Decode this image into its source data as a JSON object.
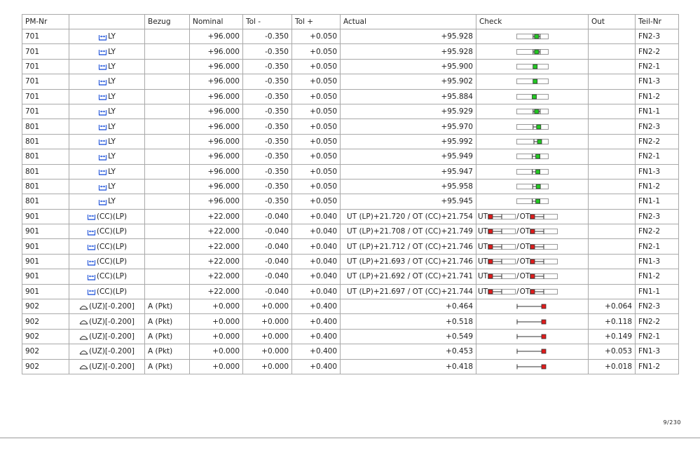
{
  "columns": [
    "PM-Nr",
    "",
    "Bezug",
    "Nominal",
    "Tol -",
    "Tol +",
    "Actual",
    "Check",
    "Out",
    "Teil-Nr"
  ],
  "colors": {
    "ok": "#22c922",
    "fail": "#e01b1b",
    "icon": "#1a4fd8"
  },
  "rows": [
    {
      "pm": "701",
      "sym_icon": "distance-y-icon",
      "feature": "LY",
      "bezug": "",
      "nominal": "+96.000",
      "tol_minus": "-0.350",
      "tol_plus": "+0.050",
      "actual": "+95.928",
      "check": {
        "kind": "single",
        "pos": 0.86,
        "status": "ok",
        "whisker": "both"
      },
      "out": "",
      "teil": "FN2-3"
    },
    {
      "pm": "701",
      "sym_icon": "distance-y-icon",
      "feature": "LY",
      "bezug": "",
      "nominal": "+96.000",
      "tol_minus": "-0.350",
      "tol_plus": "+0.050",
      "actual": "+95.928",
      "check": {
        "kind": "single",
        "pos": 0.86,
        "status": "ok",
        "whisker": "both"
      },
      "out": "",
      "teil": "FN2-2"
    },
    {
      "pm": "701",
      "sym_icon": "distance-y-icon",
      "feature": "LY",
      "bezug": "",
      "nominal": "+96.000",
      "tol_minus": "-0.350",
      "tol_plus": "+0.050",
      "actual": "+95.900",
      "check": {
        "kind": "single",
        "pos": 0.79,
        "status": "ok",
        "whisker": "none"
      },
      "out": "",
      "teil": "FN2-1"
    },
    {
      "pm": "701",
      "sym_icon": "distance-y-icon",
      "feature": "LY",
      "bezug": "",
      "nominal": "+96.000",
      "tol_minus": "-0.350",
      "tol_plus": "+0.050",
      "actual": "+95.902",
      "check": {
        "kind": "single",
        "pos": 0.79,
        "status": "ok",
        "whisker": "none"
      },
      "out": "",
      "teil": "FN1-3"
    },
    {
      "pm": "701",
      "sym_icon": "distance-y-icon",
      "feature": "LY",
      "bezug": "",
      "nominal": "+96.000",
      "tol_minus": "-0.350",
      "tol_plus": "+0.050",
      "actual": "+95.884",
      "check": {
        "kind": "single",
        "pos": 0.75,
        "status": "ok",
        "whisker": "none"
      },
      "out": "",
      "teil": "FN1-2"
    },
    {
      "pm": "701",
      "sym_icon": "distance-y-icon",
      "feature": "LY",
      "bezug": "",
      "nominal": "+96.000",
      "tol_minus": "-0.350",
      "tol_plus": "+0.050",
      "actual": "+95.929",
      "check": {
        "kind": "single",
        "pos": 0.86,
        "status": "ok",
        "whisker": "both"
      },
      "out": "",
      "teil": "FN1-1"
    },
    {
      "pm": "801",
      "sym_icon": "distance-y-icon",
      "feature": "LY",
      "bezug": "",
      "nominal": "+96.000",
      "tol_minus": "-0.350",
      "tol_plus": "+0.050",
      "actual": "+95.970",
      "check": {
        "kind": "single",
        "pos": 0.96,
        "status": "ok",
        "whisker": "left"
      },
      "out": "",
      "teil": "FN2-3"
    },
    {
      "pm": "801",
      "sym_icon": "distance-y-icon",
      "feature": "LY",
      "bezug": "",
      "nominal": "+96.000",
      "tol_minus": "-0.350",
      "tol_plus": "+0.050",
      "actual": "+95.992",
      "check": {
        "kind": "single",
        "pos": 1.0,
        "status": "ok",
        "whisker": "left"
      },
      "out": "",
      "teil": "FN2-2"
    },
    {
      "pm": "801",
      "sym_icon": "distance-y-icon",
      "feature": "LY",
      "bezug": "",
      "nominal": "+96.000",
      "tol_minus": "-0.350",
      "tol_plus": "+0.050",
      "actual": "+95.949",
      "check": {
        "kind": "single",
        "pos": 0.92,
        "status": "ok",
        "whisker": "left"
      },
      "out": "",
      "teil": "FN2-1"
    },
    {
      "pm": "801",
      "sym_icon": "distance-y-icon",
      "feature": "LY",
      "bezug": "",
      "nominal": "+96.000",
      "tol_minus": "-0.350",
      "tol_plus": "+0.050",
      "actual": "+95.947",
      "check": {
        "kind": "single",
        "pos": 0.92,
        "status": "ok",
        "whisker": "left"
      },
      "out": "",
      "teil": "FN1-3"
    },
    {
      "pm": "801",
      "sym_icon": "distance-y-icon",
      "feature": "LY",
      "bezug": "",
      "nominal": "+96.000",
      "tol_minus": "-0.350",
      "tol_plus": "+0.050",
      "actual": "+95.958",
      "check": {
        "kind": "single",
        "pos": 0.94,
        "status": "ok",
        "whisker": "left"
      },
      "out": "",
      "teil": "FN1-2"
    },
    {
      "pm": "801",
      "sym_icon": "distance-y-icon",
      "feature": "LY",
      "bezug": "",
      "nominal": "+96.000",
      "tol_minus": "-0.350",
      "tol_plus": "+0.050",
      "actual": "+95.945",
      "check": {
        "kind": "single",
        "pos": 0.92,
        "status": "ok",
        "whisker": "left"
      },
      "out": "",
      "teil": "FN1-1"
    },
    {
      "pm": "901",
      "sym_icon": "distance-y-icon",
      "feature": "(CC)(LP)",
      "bezug": "",
      "nominal": "+22.000",
      "tol_minus": "-0.040",
      "tol_plus": "+0.040",
      "actual": "UT (LP)+21.720 / OT (CC)+21.754",
      "check": {
        "kind": "dual",
        "ut_label": "UT",
        "sep": "/",
        "ot_label": "OT"
      },
      "out": "",
      "teil": "FN2-3"
    },
    {
      "pm": "901",
      "sym_icon": "distance-y-icon",
      "feature": "(CC)(LP)",
      "bezug": "",
      "nominal": "+22.000",
      "tol_minus": "-0.040",
      "tol_plus": "+0.040",
      "actual": "UT (LP)+21.708 / OT (CC)+21.749",
      "check": {
        "kind": "dual",
        "ut_label": "UT",
        "sep": "/",
        "ot_label": "OT"
      },
      "out": "",
      "teil": "FN2-2"
    },
    {
      "pm": "901",
      "sym_icon": "distance-y-icon",
      "feature": "(CC)(LP)",
      "bezug": "",
      "nominal": "+22.000",
      "tol_minus": "-0.040",
      "tol_plus": "+0.040",
      "actual": "UT (LP)+21.712 / OT (CC)+21.746",
      "check": {
        "kind": "dual",
        "ut_label": "UT",
        "sep": "/",
        "ot_label": "OT"
      },
      "out": "",
      "teil": "FN2-1"
    },
    {
      "pm": "901",
      "sym_icon": "distance-y-icon",
      "feature": "(CC)(LP)",
      "bezug": "",
      "nominal": "+22.000",
      "tol_minus": "-0.040",
      "tol_plus": "+0.040",
      "actual": "UT (LP)+21.693 / OT (CC)+21.746",
      "check": {
        "kind": "dual",
        "ut_label": "UT",
        "sep": "/",
        "ot_label": "OT"
      },
      "out": "",
      "teil": "FN1-3"
    },
    {
      "pm": "901",
      "sym_icon": "distance-y-icon",
      "feature": "(CC)(LP)",
      "bezug": "",
      "nominal": "+22.000",
      "tol_minus": "-0.040",
      "tol_plus": "+0.040",
      "actual": "UT (LP)+21.692 / OT (CC)+21.741",
      "check": {
        "kind": "dual",
        "ut_label": "UT",
        "sep": "/",
        "ot_label": "OT"
      },
      "out": "",
      "teil": "FN1-2"
    },
    {
      "pm": "901",
      "sym_icon": "distance-y-icon",
      "feature": "(CC)(LP)",
      "bezug": "",
      "nominal": "+22.000",
      "tol_minus": "-0.040",
      "tol_plus": "+0.040",
      "actual": "UT (LP)+21.697 / OT (CC)+21.744",
      "check": {
        "kind": "dual",
        "ut_label": "UT",
        "sep": "/",
        "ot_label": "OT"
      },
      "out": "",
      "teil": "FN1-1"
    },
    {
      "pm": "902",
      "sym_icon": "surface-profile-icon",
      "feature": "(UZ)[-0.200]",
      "bezug": "A (Pkt)",
      "nominal": "+0.000",
      "tol_minus": "+0.000",
      "tol_plus": "+0.400",
      "actual": "+0.464",
      "check": {
        "kind": "over",
        "status": "fail"
      },
      "out": "+0.064",
      "teil": "FN2-3"
    },
    {
      "pm": "902",
      "sym_icon": "surface-profile-icon",
      "feature": "(UZ)[-0.200]",
      "bezug": "A (Pkt)",
      "nominal": "+0.000",
      "tol_minus": "+0.000",
      "tol_plus": "+0.400",
      "actual": "+0.518",
      "check": {
        "kind": "over",
        "status": "fail"
      },
      "out": "+0.118",
      "teil": "FN2-2"
    },
    {
      "pm": "902",
      "sym_icon": "surface-profile-icon",
      "feature": "(UZ)[-0.200]",
      "bezug": "A (Pkt)",
      "nominal": "+0.000",
      "tol_minus": "+0.000",
      "tol_plus": "+0.400",
      "actual": "+0.549",
      "check": {
        "kind": "over",
        "status": "fail"
      },
      "out": "+0.149",
      "teil": "FN2-1"
    },
    {
      "pm": "902",
      "sym_icon": "surface-profile-icon",
      "feature": "(UZ)[-0.200]",
      "bezug": "A (Pkt)",
      "nominal": "+0.000",
      "tol_minus": "+0.000",
      "tol_plus": "+0.400",
      "actual": "+0.453",
      "check": {
        "kind": "over",
        "status": "fail"
      },
      "out": "+0.053",
      "teil": "FN1-3"
    },
    {
      "pm": "902",
      "sym_icon": "surface-profile-icon",
      "feature": "(UZ)[-0.200]",
      "bezug": "A (Pkt)",
      "nominal": "+0.000",
      "tol_minus": "+0.000",
      "tol_plus": "+0.400",
      "actual": "+0.418",
      "check": {
        "kind": "over",
        "status": "fail"
      },
      "out": "+0.018",
      "teil": "FN1-2"
    }
  ],
  "footer": {
    "page": "9/230"
  }
}
